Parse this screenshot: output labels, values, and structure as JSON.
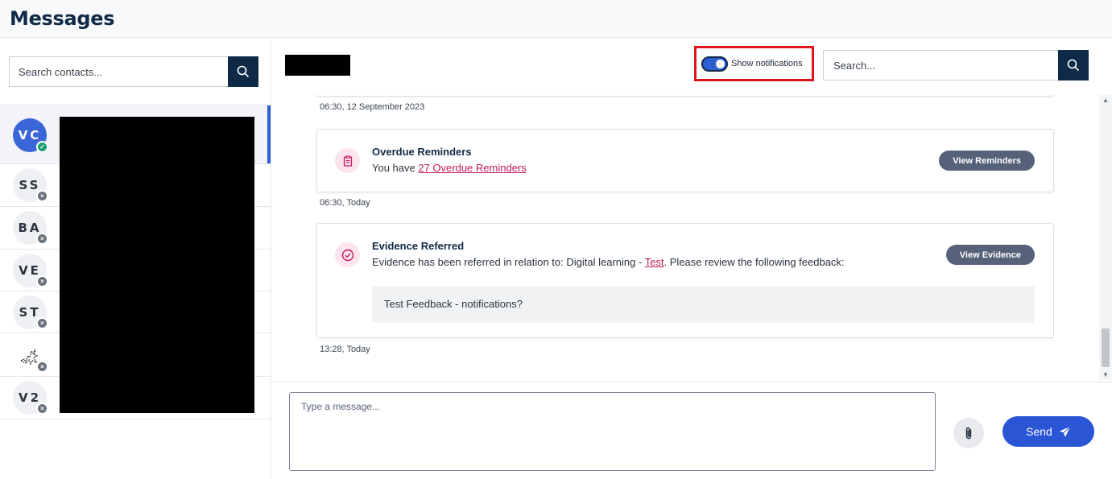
{
  "page": {
    "title": "Messages"
  },
  "sidebar": {
    "search_placeholder": "Search contacts...",
    "contacts": [
      {
        "initials": "VC",
        "status": "online",
        "active": true
      },
      {
        "initials": "SS",
        "status": "offline",
        "active": false
      },
      {
        "initials": "BA",
        "status": "offline",
        "active": false
      },
      {
        "initials": "VE",
        "status": "offline",
        "active": false
      },
      {
        "initials": "ST",
        "status": "offline",
        "active": false
      },
      {
        "initials": "",
        "status": "offline",
        "active": false,
        "image_avatar": true
      },
      {
        "initials": "V2",
        "status": "offline",
        "active": false
      }
    ]
  },
  "header": {
    "notifications_label": "Show notifications",
    "notifications_on": true,
    "search_placeholder": "Search..."
  },
  "feed": {
    "items": [
      {
        "timestamp": "06:30, 12 September 2023"
      },
      {
        "title": "Overdue Reminders",
        "text_prefix": "You have ",
        "link": "27 Overdue Reminders",
        "action": "View Reminders",
        "timestamp": "06:30, Today"
      },
      {
        "title": "Evidence Referred",
        "text_prefix": "Evidence has been referred in relation to: Digital learning - ",
        "link": "Test",
        "text_suffix": ". Please review the following feedback:",
        "feedback": "Test Feedback - notifications?",
        "action": "View Evidence",
        "timestamp": "13:28, Today"
      }
    ]
  },
  "composer": {
    "placeholder": "Type a message...",
    "send_label": "Send"
  },
  "colors": {
    "brand_dark": "#0e2a47",
    "accent_blue": "#2a55d5",
    "link_pink": "#c2185b",
    "highlight_red": "#e0141b"
  }
}
